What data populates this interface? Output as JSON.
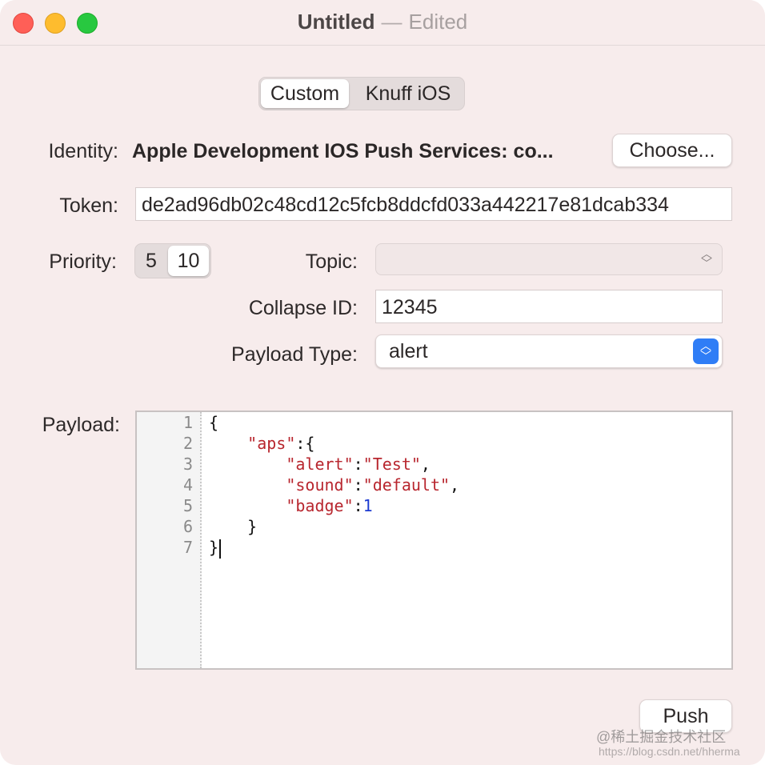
{
  "window": {
    "title": "Untitled",
    "title_separator": "—",
    "title_status": "Edited"
  },
  "mode_tabs": [
    {
      "label": "Custom",
      "selected": true
    },
    {
      "label": "Knuff iOS",
      "selected": false
    }
  ],
  "identity": {
    "label": "Identity:",
    "value": "Apple Development IOS Push Services: co...",
    "choose_label": "Choose..."
  },
  "token": {
    "label": "Token:",
    "value": "de2ad96db02c48cd12c5fcb8ddcfd033a442217e81dcab334"
  },
  "priority": {
    "label": "Priority:",
    "options": [
      "5",
      "10"
    ],
    "selected": "10"
  },
  "topic": {
    "label": "Topic:",
    "value": ""
  },
  "collapse_id": {
    "label": "Collapse ID:",
    "value": "12345"
  },
  "payload_type": {
    "label": "Payload Type:",
    "value": "alert"
  },
  "payload": {
    "label": "Payload:",
    "line_numbers": [
      "1",
      "2",
      "3",
      "4",
      "5",
      "6",
      "7"
    ],
    "lines": {
      "l1": "{",
      "l2_key": "\"aps\"",
      "l2_rest": ":{",
      "l3_key": "\"alert\"",
      "l3_colon": ":",
      "l3_val": "\"Test\"",
      "l3_end": ",",
      "l4_key": "\"sound\"",
      "l4_colon": ":",
      "l4_val": "\"default\"",
      "l4_end": ",",
      "l5_key": "\"badge\"",
      "l5_colon": ":",
      "l5_val": "1",
      "l6": "}",
      "l7": "}"
    }
  },
  "push_label": "Push",
  "watermark": {
    "line1": "@稀土掘金技术社区",
    "line2": "https://blog.csdn.net/hherma"
  },
  "colors": {
    "window_bg": "#f7ecec",
    "close": "#ff5f57",
    "minimize": "#febc2e",
    "maximize": "#28c840",
    "accent": "#2f7df6",
    "json_string": "#b8262e",
    "json_number": "#1d3bd1"
  }
}
